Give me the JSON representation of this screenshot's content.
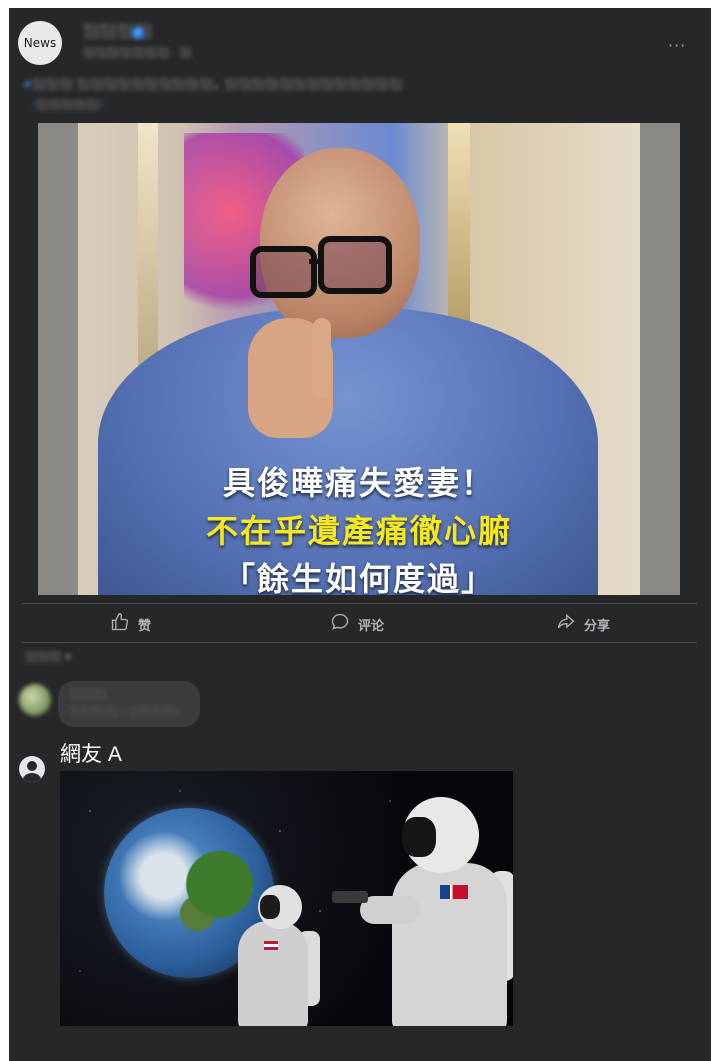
{
  "post": {
    "avatar_label": "News",
    "page_name": "⬛⬛⬛⬛",
    "meta": "⬛⬛⬛⬛⬛⬛⬛ · ⬛",
    "caption_tag": "#⬛⬛⬛",
    "caption_text": "⬛⬛⬛⬛⬛⬛⬛⬛⬛⬛，⬛⬛⬛⬛⬛⬛⬛⬛⬛⬛⬛⬛⬛",
    "caption_link": "（⬛⬛⬛⬛⬛）",
    "headline": [
      "具俊曄痛失愛妻！",
      "不在乎遺產痛徹心腑",
      "「餘生如何度過」"
    ]
  },
  "actions": {
    "like": "赞",
    "comment": "评论",
    "share": "分享"
  },
  "comments": {
    "sort_label": "⬛⬛⬛ ▾",
    "first": {
      "name": "⬛⬛⬛",
      "text": "⬛⬛⬛⬛ · ⬛⬛⬛⬛"
    },
    "reply_user": "網友 A"
  },
  "colors": {
    "card_bg": "#262729",
    "headline_yellow": "#f6e81f",
    "link_blue": "#4599ff"
  }
}
